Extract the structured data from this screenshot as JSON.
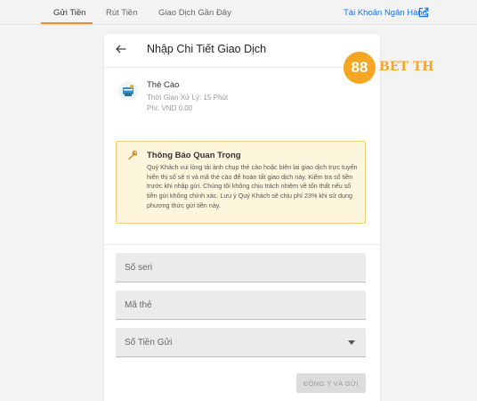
{
  "nav": {
    "tabs": [
      {
        "label": "Gửi Tiền",
        "active": true
      },
      {
        "label": "Rút Tiền",
        "active": false
      },
      {
        "label": "Giao Dịch Gần Đây",
        "active": false
      }
    ],
    "bank_link": "Tài Khoản Ngân Hàng",
    "bank_link_icon": "external-link-icon",
    "accent_color": "#f08a24"
  },
  "header": {
    "title": "Nhập Chi Tiết Giao Dịch",
    "back_icon": "arrow-left-icon"
  },
  "method": {
    "icon": "phone-card-icon",
    "name": "Thẻ Cào",
    "processing_time": "Thời Gian Xử Lý: 15 Phút",
    "fee": "Phí: VND 0.00"
  },
  "notice": {
    "icon": "wrench-icon",
    "title": "Thông Báo Quan Trọng",
    "body": "Quý Khách vui lòng tải ảnh chụp thẻ cào hoặc biên lai giao dịch trực tuyến hiển thị số sê ri và mã thẻ cào để hoàn tất giao dịch này. Kiểm tra số tiền trước khi nhập gửi. Chúng tôi không chịu trách nhiệm về tổn thất nếu số tiền gửi không chính xác. Lưu ý Quý Khách sẽ chịu phí 23% khi sử dụng phương thức gửi tiền này.",
    "background": "#fdf5dc",
    "border": "#f1cd76"
  },
  "form": {
    "serial": {
      "placeholder": "Số seri",
      "value": ""
    },
    "card_code": {
      "placeholder": "Mã thẻ",
      "value": ""
    },
    "amount": {
      "label": "Số Tiền Gửi",
      "icon": "caret-down-icon"
    },
    "submit_label": "ĐỒNG Ý VÀ GỬI"
  },
  "watermark": {
    "number": "88",
    "text": "BET TH",
    "color": "#f5a623"
  }
}
